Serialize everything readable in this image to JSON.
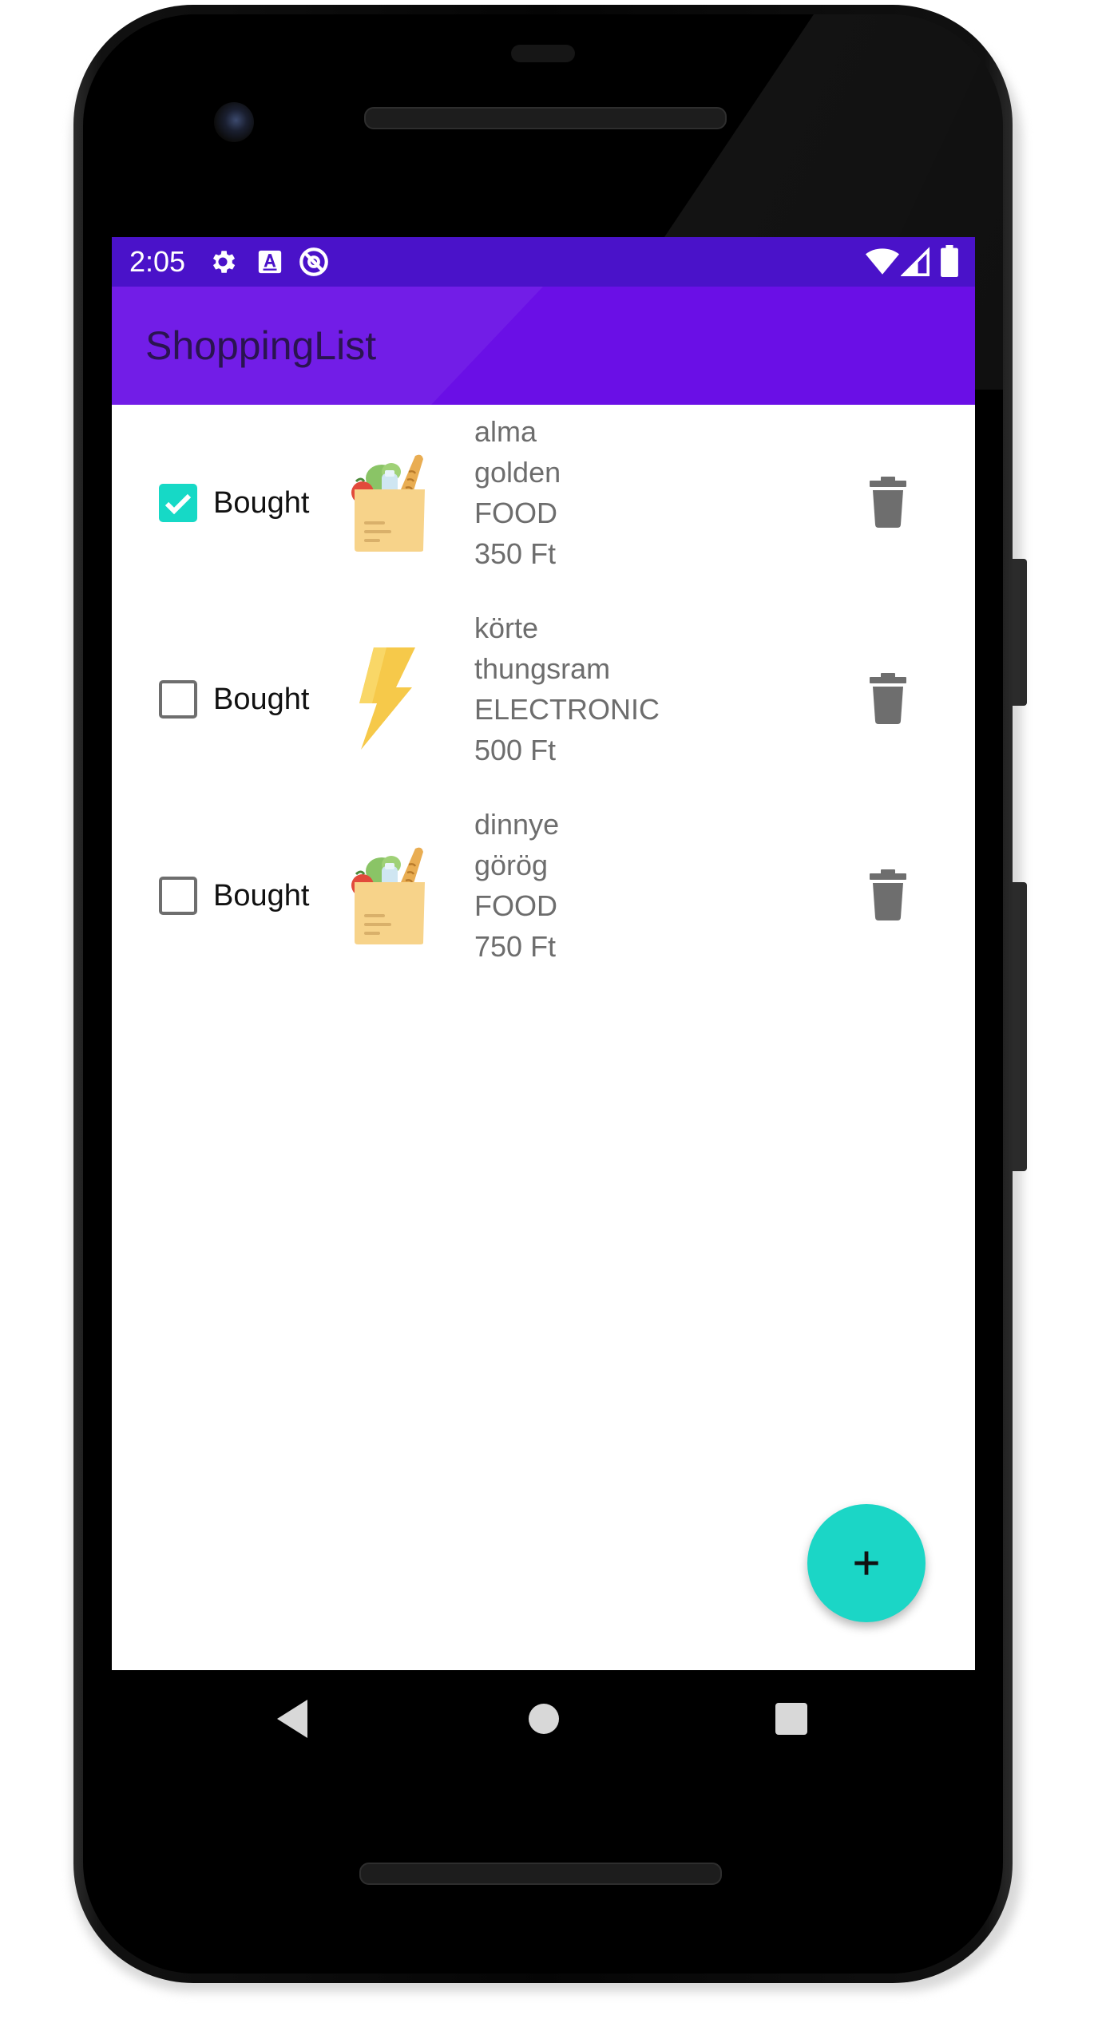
{
  "status_bar": {
    "time": "2:05",
    "left_icons": [
      "gear-icon",
      "a-text-icon",
      "no-disturb-icon"
    ],
    "right_icons": [
      "wifi-icon",
      "signal-icon",
      "battery-icon"
    ]
  },
  "app_bar": {
    "title": "ShoppingList"
  },
  "items": [
    {
      "checked": true,
      "checkbox_label": "Bought",
      "icon": "grocery-bag-icon",
      "name": "alma",
      "description": "golden",
      "category": "FOOD",
      "price": "350 Ft"
    },
    {
      "checked": false,
      "checkbox_label": "Bought",
      "icon": "lightning-icon",
      "name": "körte",
      "description": "thungsram",
      "category": "ELECTRONIC",
      "price": "500 Ft"
    },
    {
      "checked": false,
      "checkbox_label": "Bought",
      "icon": "grocery-bag-icon",
      "name": "dinnye",
      "description": "görög",
      "category": "FOOD",
      "price": "750 Ft"
    }
  ],
  "fab": {
    "icon": "plus-icon"
  },
  "nav_bar": {
    "buttons": [
      "back-icon",
      "home-icon",
      "recents-icon"
    ]
  },
  "colors": {
    "status_bar": "#4a12c9",
    "app_bar": "#6a0fe6",
    "accent": "#1bd6c6",
    "item_text": "#6d6d6d",
    "delete_icon": "#6e6e6e"
  }
}
